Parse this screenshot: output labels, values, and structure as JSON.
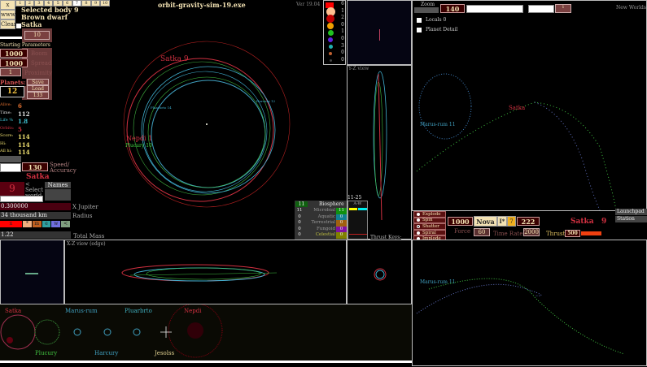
{
  "window": {
    "title": "orbit-gravity-sim-19.exe",
    "version": "Ver 19.04"
  },
  "top_buttons": {
    "x": "x",
    "www": "www",
    "clear": "Clear",
    "tabs": [
      "1",
      "2",
      "3",
      "4",
      "5",
      "6",
      "7",
      "8",
      "9",
      "10"
    ],
    "active_tab": "7"
  },
  "selected": {
    "line1": "Selected body 9",
    "line2": "Brown dwarf",
    "line3": "Satka"
  },
  "params": {
    "top_value": "10",
    "heading": "Starting Parameters",
    "boom_value": "1000",
    "boom_label": "Boom",
    "spread_value": "1000",
    "spread_label": "Spread",
    "proximity_value": "1",
    "proximity_label": "Proximity",
    "planets_label": "Planets:",
    "planets_value": "12",
    "save": "Save",
    "load": "Load",
    "seed": "133"
  },
  "stats": [
    {
      "label": "Alive:",
      "value": "6",
      "color": "#e07030"
    },
    {
      "label": "Time:",
      "value": "112",
      "color": "#ddd"
    },
    {
      "label": "Life %",
      "value": "1.8",
      "color": "#40c0d0"
    },
    {
      "label": "Orbits:",
      "value": "5",
      "color": "#d03040"
    },
    {
      "label": "Score:",
      "value": "114",
      "color": "#f0e070"
    },
    {
      "label": "Hi:",
      "value": "114",
      "color": "#f0e070"
    },
    {
      "label": "All hi:",
      "value": "114",
      "color": "#f0e070"
    }
  ],
  "speed": {
    "value": "130",
    "label": "Speed/ Accuracy"
  },
  "world": {
    "name": "Satka",
    "number": "9",
    "select_label": "< Select world",
    "names_button": "Names"
  },
  "body": {
    "mass_value": "0.300000",
    "mass_unit": "X Jupiter",
    "radius_value": "34 thousand km",
    "radius_label": "Radius",
    "total_mass_value": "1.22",
    "total_mass_label": "Total Mass",
    "color_buttons": [
      {
        "t": "x",
        "c": "#ff0000"
      },
      {
        "t": "*",
        "c": "#f0b080"
      },
      {
        "t": "m",
        "c": "#c06020"
      },
      {
        "t": "e",
        "c": "#30a0a0"
      },
      {
        "t": "w",
        "c": "#7070e0"
      },
      {
        "t": "<",
        "c": "#80a080"
      }
    ]
  },
  "legend": {
    "counts": [
      "6",
      "1",
      "2",
      "0",
      "1",
      "0",
      "3",
      "0",
      "0"
    ],
    "colors": [
      "#ff0000",
      "#ffc090",
      "#c00000",
      "#f0a000",
      "#20c020",
      "#6020e0",
      "#20b0b0",
      "#c06030",
      "#444"
    ]
  },
  "views": {
    "yz": "Y-Z view",
    "xz": "X-Z view (edge)",
    "thrust_keys": "Thrust Keys:",
    "new_worlds": "New Worlds"
  },
  "main_labels": [
    {
      "t": "Satka 9",
      "c": "#d03040"
    },
    {
      "t": "Pluarbrto 14",
      "c": "#40b0d0"
    },
    {
      "t": "Harcury 12",
      "c": "#40b0d0"
    },
    {
      "t": "Nepdi 1",
      "c": "#d03040"
    },
    {
      "t": "Plucury 10",
      "c": "#40d040"
    }
  ],
  "biosphere": {
    "title": "Biosphere",
    "total": "11",
    "range": "11-25",
    "aw": "A-W",
    "rows": [
      {
        "n": "11",
        "label": "Microbial",
        "v": "11",
        "c": "#109010"
      },
      {
        "n": "0",
        "label": "Aquatic",
        "v": "0",
        "c": "#108090"
      },
      {
        "n": "0",
        "label": "Terrestrial",
        "v": "0",
        "c": "#a06010"
      },
      {
        "n": "0",
        "label": "Fungoid",
        "v": "0",
        "c": "#8010a0"
      },
      {
        "n": "0",
        "label": "Celestial",
        "v": "0",
        "c": "#808000"
      }
    ]
  },
  "right_top": {
    "zoom_label": "Zoom",
    "zoom_value": "140",
    "small_value": "1",
    "locals_label": "Locals",
    "locals_value": "0",
    "planet_detail": "Planet Detail",
    "labels": [
      {
        "t": "Satka",
        "c": "#d03040"
      },
      {
        "t": "Marus-rum 11",
        "c": "#40a0c0"
      }
    ]
  },
  "controls": {
    "modes": [
      "Explode",
      "Spin",
      "Shatter",
      "Spiral",
      "Implode"
    ],
    "selected_mode": "Shatter",
    "force_value": "1000",
    "force_label": "Force",
    "nova": "Nova",
    "i_star": "I*",
    "seven": "7",
    "num222": "222",
    "time_value": "60",
    "time_label": "Time Rates",
    "time2": "2000",
    "thrust_label": "Thrust",
    "thrust_value": "500",
    "body_name": "Satka",
    "body_num": "9",
    "launchpad": "Launchpad",
    "station": "Station"
  },
  "right_bottom": {
    "label": "Marus-rum 11"
  },
  "planet_strip": [
    {
      "t": "Satka",
      "c": "#d03040"
    },
    {
      "t": "Plucury",
      "c": "#40c040"
    },
    {
      "t": "Marus-rum",
      "c": "#40a0c0"
    },
    {
      "t": "Harcury",
      "c": "#40a0c0"
    },
    {
      "t": "Pluarbrto",
      "c": "#40b0c0"
    },
    {
      "t": "Jesolss",
      "c": "#e0d090"
    },
    {
      "t": "Nepdi",
      "c": "#d03040"
    }
  ]
}
